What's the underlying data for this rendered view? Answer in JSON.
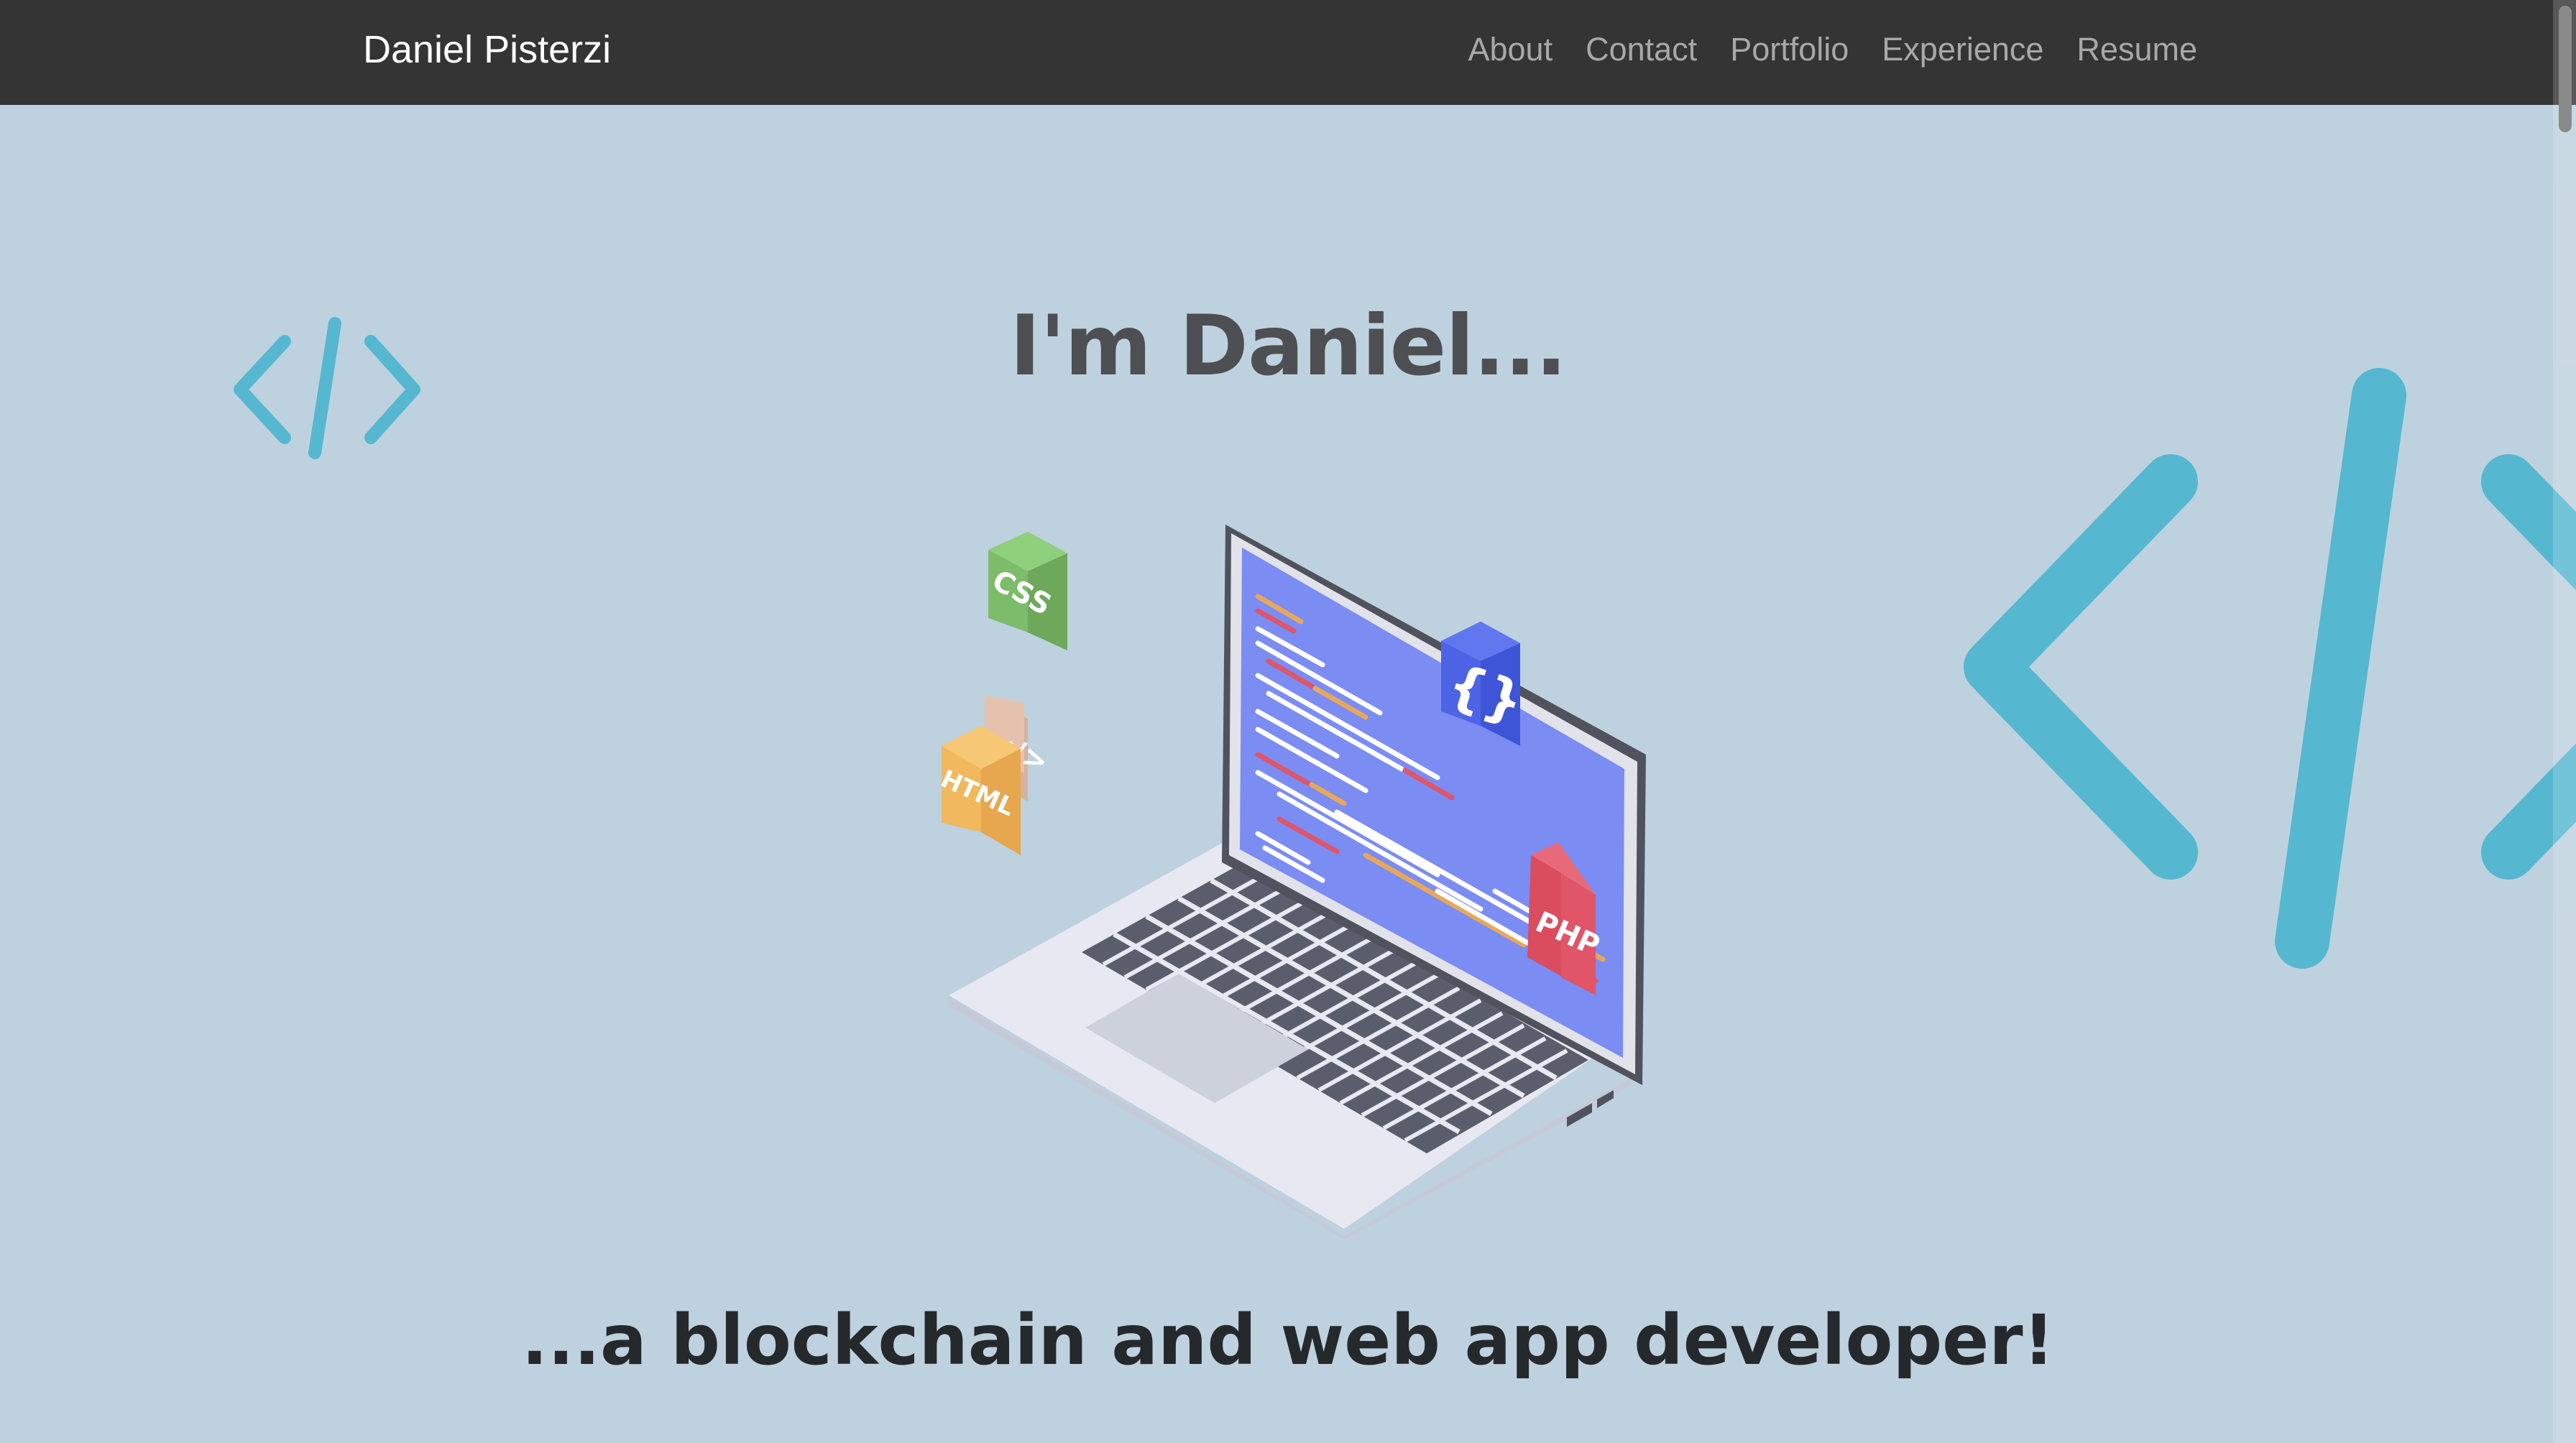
{
  "header": {
    "brand": "Daniel Pisterzi",
    "nav": [
      {
        "label": "About"
      },
      {
        "label": "Contact"
      },
      {
        "label": "Portfolio"
      },
      {
        "label": "Experience"
      },
      {
        "label": "Resume"
      }
    ]
  },
  "hero": {
    "title": "I'm Daniel...",
    "subtitle": "...a blockchain and web app developer!"
  },
  "illustration": {
    "badges": {
      "css": "CSS",
      "html": "HTML",
      "tag": "</>",
      "braces": "{}",
      "php": "PHP"
    }
  },
  "icons": [
    "code-icon",
    "code-icon-large",
    "laptop-illustration"
  ],
  "colors": {
    "navbar": "#343434",
    "background": "#bed1de",
    "accent": "#55b8d0",
    "screen": "#7b8cf2"
  }
}
